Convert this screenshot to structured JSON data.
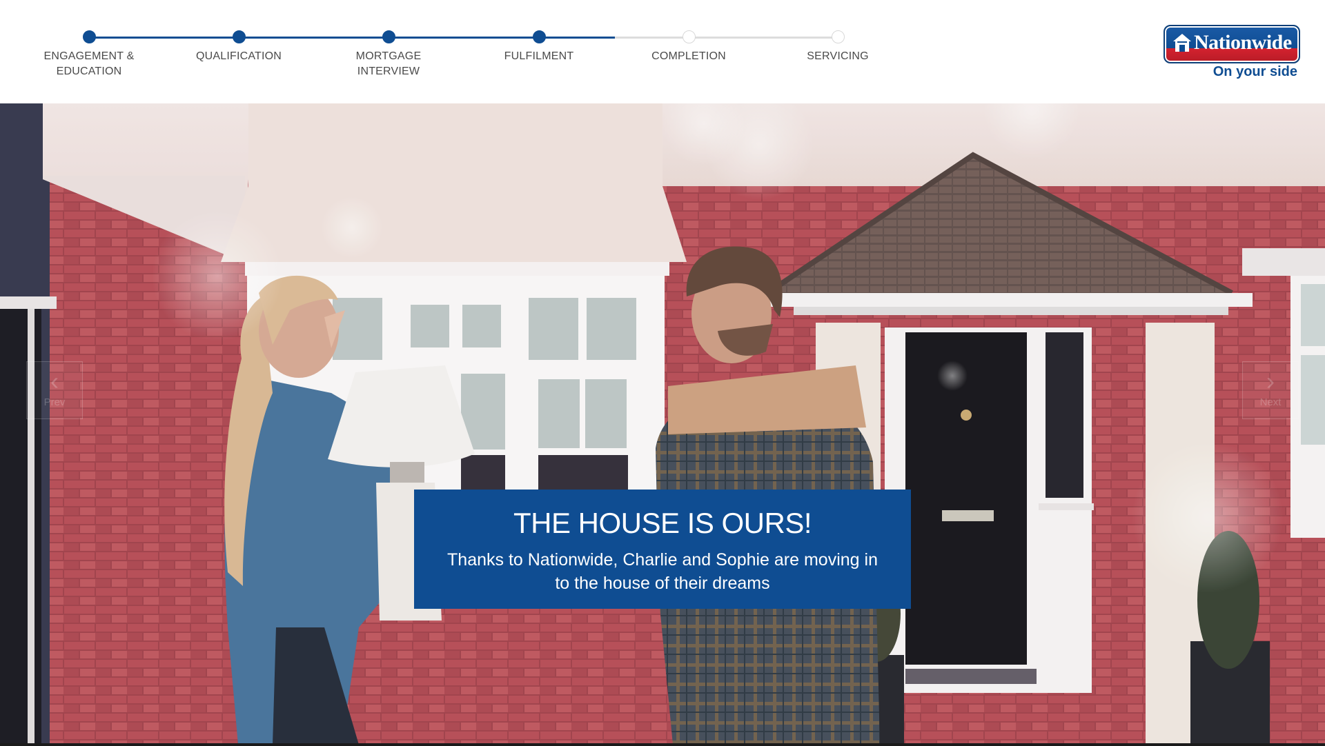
{
  "progress": {
    "steps": [
      {
        "label": "ENGAGEMENT &\nEDUCATION",
        "status": "completed"
      },
      {
        "label": "QUALIFICATION",
        "status": "completed"
      },
      {
        "label": "MORTGAGE\nINTERVIEW",
        "status": "completed"
      },
      {
        "label": "FULFILMENT",
        "status": "current"
      },
      {
        "label": "COMPLETION",
        "status": "pending"
      },
      {
        "label": "SERVICING",
        "status": "pending"
      }
    ]
  },
  "brand": {
    "name": "Nationwide",
    "tagline": "On your side",
    "primary_color": "#0f4d92",
    "secondary_color": "#d3222f"
  },
  "slide": {
    "title": "THE HOUSE IS OURS!",
    "text": "Thanks to Nationwide, Charlie and Sophie are moving in to the house of their dreams"
  },
  "carousel": {
    "prev_label": "Prev",
    "next_label": "Next",
    "prev_icon": "chevron-left-icon",
    "next_icon": "chevron-right-icon"
  }
}
